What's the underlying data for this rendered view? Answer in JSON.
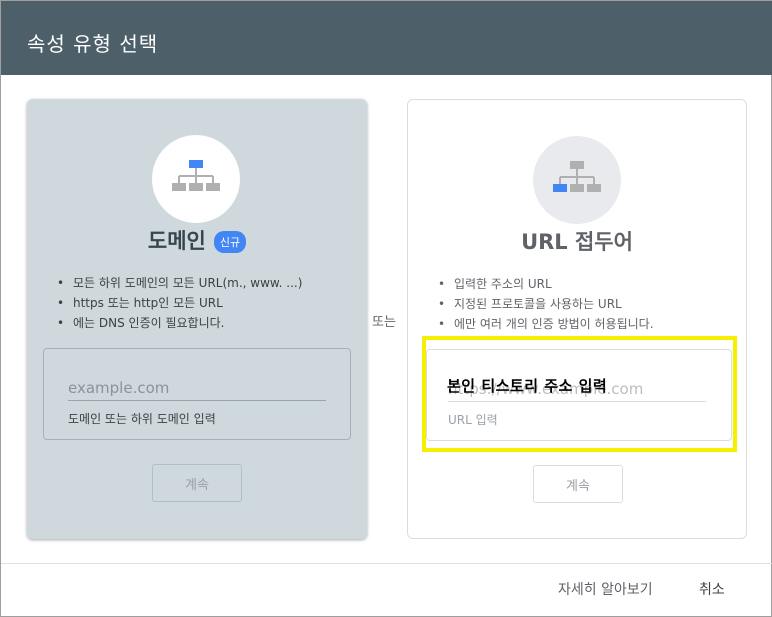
{
  "header": {
    "title": "속성 유형 선택"
  },
  "domain_card": {
    "title": "도메인",
    "badge": "신규",
    "bullets": [
      "모든 하위 도메인의 모든 URL(m., www. ...)",
      "https 또는 http인 모든 URL",
      "에는 DNS 인증이 필요합니다."
    ],
    "input_placeholder": "example.com",
    "input_hint": "도메인 또는 하위 도메인 입력",
    "continue_label": "계속",
    "icon": "sitemap-icon",
    "accent_color": "#4285f4"
  },
  "or_label": "또는",
  "url_card": {
    "title": "URL 접두어",
    "bullets": [
      "입력한 주소의 URL",
      "지정된 프로토콜을 사용하는 URL",
      "에만 여러 개의 인증 방법이 허용됩니다."
    ],
    "input_placeholder": "https://www.example.com",
    "input_hint": "URL 입력",
    "continue_label": "계속",
    "icon": "sitemap-icon"
  },
  "annotation": {
    "text": "본인 티스토리 주소 입력",
    "highlight_color": "#f5f000"
  },
  "footer": {
    "learn_more": "자세히 알아보기",
    "cancel": "취소"
  }
}
